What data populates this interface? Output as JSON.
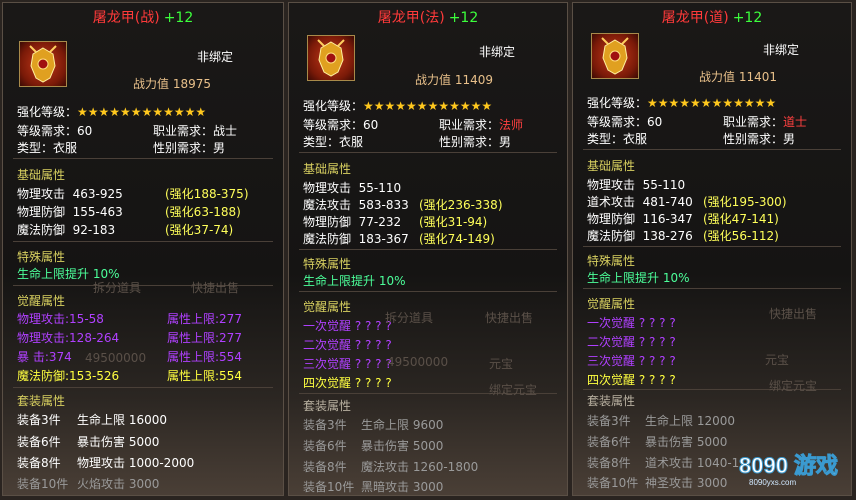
{
  "panels": [
    {
      "title": "屠龙甲(战)",
      "plus": "+12",
      "bound": "非绑定",
      "power_label": "战力值",
      "power_value": "18975",
      "enhance_label": "强化等级：",
      "stars": "★★★★★★★★★★★★",
      "level_req": "等级需求：60",
      "job_label": "职业需求：",
      "job_value": "战士",
      "type": "类型：衣服",
      "gender": "性别需求：男",
      "base_title": "基础属性",
      "base": [
        {
          "name": "物理攻击",
          "value": "463-925",
          "bonus": "(强化188-375)"
        },
        {
          "name": "物理防御",
          "value": "155-463",
          "bonus": "(强化63-188)"
        },
        {
          "name": "魔法防御",
          "value": "92-183",
          "bonus": "(强化37-74)"
        }
      ],
      "special_title": "特殊属性",
      "special": "生命上限提升  10%",
      "awaken_title": "觉醒属性",
      "awaken": [
        {
          "left": "物理攻击:15-58",
          "right": "属性上限:277"
        },
        {
          "left": "物理攻击:128-264",
          "right": "属性上限:277"
        },
        {
          "left": "暴      击:374",
          "right": "属性上限:554"
        },
        {
          "left": "魔法防御:153-526",
          "right": "属性上限:554"
        }
      ],
      "set_title": "套装属性",
      "set": [
        {
          "n": "装备3件",
          "t": "生命上限 16000"
        },
        {
          "n": "装备6件",
          "t": "暴击伤害 5000"
        },
        {
          "n": "装备8件",
          "t": "物理攻击 1000-2000"
        },
        {
          "n": "装备10件",
          "t": "火焰攻击 3000"
        }
      ]
    },
    {
      "title": "屠龙甲(法)",
      "plus": "+12",
      "bound": "非绑定",
      "power_label": "战力值",
      "power_value": "11409",
      "enhance_label": "强化等级：",
      "stars": "★★★★★★★★★★★★",
      "level_req": "等级需求：60",
      "job_label": "职业需求：",
      "job_value": "法师",
      "type": "类型：衣服",
      "gender": "性别需求：男",
      "base_title": "基础属性",
      "base": [
        {
          "name": "物理攻击",
          "value": "55-110",
          "bonus": ""
        },
        {
          "name": "魔法攻击",
          "value": "583-833",
          "bonus": "(强化236-338)"
        },
        {
          "name": "物理防御",
          "value": "77-232",
          "bonus": "(强化31-94)"
        },
        {
          "name": "魔法防御",
          "value": "183-367",
          "bonus": "(强化74-149)"
        }
      ],
      "special_title": "特殊属性",
      "special": "生命上限提升  10%",
      "awaken_title": "觉醒属性",
      "awaken": [
        {
          "left": "一次觉醒 ? ? ? ?"
        },
        {
          "left": "二次觉醒 ? ? ? ?"
        },
        {
          "left": "三次觉醒 ? ? ? ?"
        },
        {
          "left": "四次觉醒 ? ? ? ?"
        }
      ],
      "set_title": "套装属性",
      "set": [
        {
          "n": "装备3件",
          "t": "生命上限 9600"
        },
        {
          "n": "装备6件",
          "t": "暴击伤害 5000"
        },
        {
          "n": "装备8件",
          "t": "魔法攻击 1260-1800"
        },
        {
          "n": "装备10件",
          "t": "黑暗攻击 3000"
        }
      ]
    },
    {
      "title": "屠龙甲(道)",
      "plus": "+12",
      "bound": "非绑定",
      "power_label": "战力值",
      "power_value": "11401",
      "enhance_label": "强化等级：",
      "stars": "★★★★★★★★★★★★",
      "level_req": "等级需求：60",
      "job_label": "职业需求：",
      "job_value": "道士",
      "type": "类型：衣服",
      "gender": "性别需求：男",
      "base_title": "基础属性",
      "base": [
        {
          "name": "物理攻击",
          "value": "55-110",
          "bonus": ""
        },
        {
          "name": "道术攻击",
          "value": "481-740",
          "bonus": "(强化195-300)"
        },
        {
          "name": "物理防御",
          "value": "116-347",
          "bonus": "(强化47-141)"
        },
        {
          "name": "魔法防御",
          "value": "138-276",
          "bonus": "(强化56-112)"
        }
      ],
      "special_title": "特殊属性",
      "special": "生命上限提升  10%",
      "awaken_title": "觉醒属性",
      "awaken": [
        {
          "left": "一次觉醒 ? ? ? ?"
        },
        {
          "left": "二次觉醒 ? ? ? ?"
        },
        {
          "left": "三次觉醒 ? ? ? ?"
        },
        {
          "left": "四次觉醒 ? ? ? ?"
        }
      ],
      "set_title": "套装属性",
      "set": [
        {
          "n": "装备3件",
          "t": "生命上限 12000"
        },
        {
          "n": "装备6件",
          "t": "暴击伤害 5000"
        },
        {
          "n": "装备8件",
          "t": "道术攻击 1040-1"
        },
        {
          "n": "装备10件",
          "t": "神圣攻击 3000"
        }
      ]
    }
  ],
  "background_text": {
    "split": "拆分道具",
    "quick_sell": "快捷出售",
    "amount": "49500000",
    "yuanbao": "元宝",
    "bind_yuanbao": "绑定元宝"
  },
  "watermark": {
    "text": "8090 游戏",
    "url": "8090yxs.com"
  },
  "icons": {
    "armor": "armor-icon"
  }
}
